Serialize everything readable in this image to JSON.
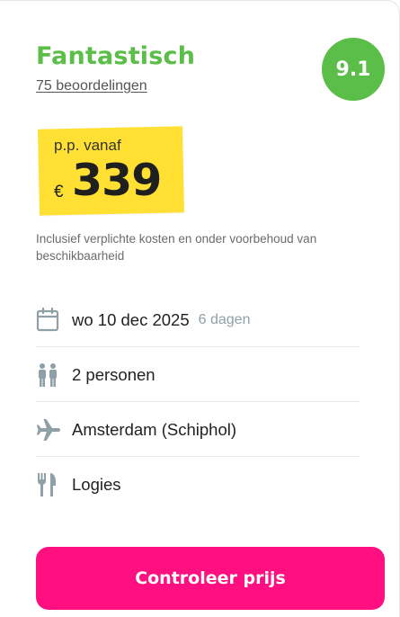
{
  "rating": {
    "label": "Fantastisch",
    "reviews": "75 beoordelingen",
    "score": "9.1",
    "color": "#5bbe48"
  },
  "price": {
    "prefix": "p.p. vanaf",
    "currency": "€",
    "amount": "339",
    "highlight_color": "#ffe033"
  },
  "disclaimer": "Inclusief verplichte kosten en onder voorbehoud van beschikbaarheid",
  "details": [
    {
      "icon": "calendar-icon",
      "text": "wo 10 dec 2025",
      "sub": "6 dagen"
    },
    {
      "icon": "persons-icon",
      "text": "2 personen"
    },
    {
      "icon": "airplane-icon",
      "text": "Amsterdam (Schiphol)"
    },
    {
      "icon": "fork-knife-icon",
      "text": "Logies"
    }
  ],
  "cta": {
    "label": "Controleer prijs",
    "color": "#ff0f80"
  }
}
